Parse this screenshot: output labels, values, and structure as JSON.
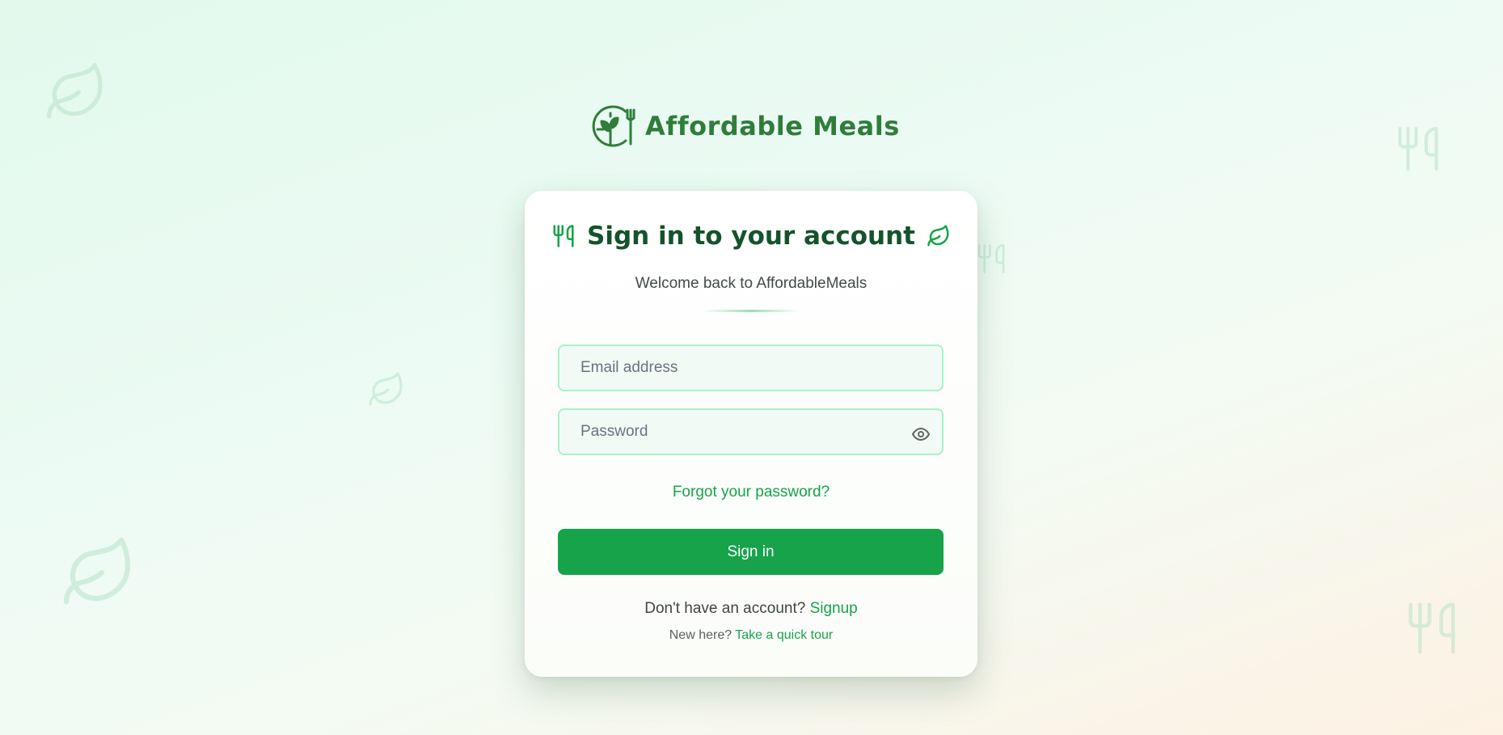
{
  "brand": {
    "name": "Affordable Meals",
    "logo_icon": "plate-sprout-fork-icon",
    "color": "#2f7d3a"
  },
  "card": {
    "title": "Sign in to your account",
    "title_icon_left": "utensils-icon",
    "title_icon_right": "leaf-icon",
    "subtitle": "Welcome back to AffordableMeals"
  },
  "form": {
    "email": {
      "placeholder": "Email address",
      "value": ""
    },
    "password": {
      "placeholder": "Password",
      "value": "",
      "toggle_icon": "eye-icon"
    },
    "forgot_label": "Forgot your password?",
    "submit_label": "Sign in"
  },
  "footer": {
    "signup_prompt": "Don't have an account?",
    "signup_link": "Signup",
    "tour_prompt": "New here?",
    "tour_link": "Take a quick tour"
  },
  "background_icons": [
    "leaf-icon",
    "leaf-icon",
    "leaf-icon",
    "utensils-icon",
    "utensils-icon",
    "utensils-icon"
  ],
  "colors": {
    "accent": "#16a34a",
    "title": "#14532d",
    "input_border": "#a7f3c6",
    "input_bg": "#f2faf5"
  }
}
